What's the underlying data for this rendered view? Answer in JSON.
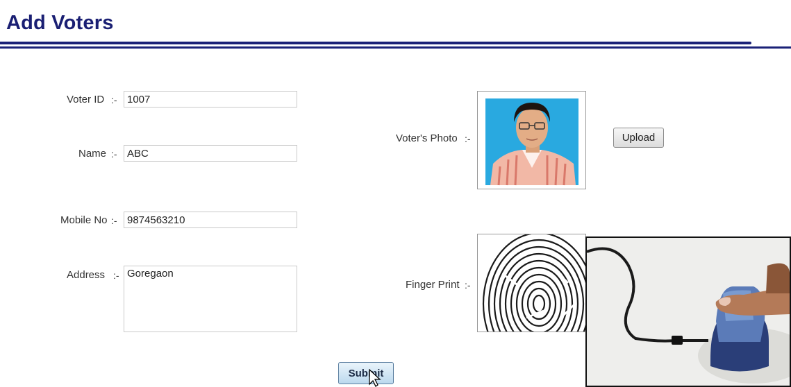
{
  "page": {
    "title": "Add Voters"
  },
  "form": {
    "voter_id": {
      "label": "Voter ID",
      "separator": ":-",
      "value": "1007"
    },
    "name": {
      "label": "Name",
      "separator": ":-",
      "value": "ABC"
    },
    "mobile_no": {
      "label": "Mobile No",
      "separator": ":-",
      "value": "9874563210"
    },
    "address": {
      "label": "Address",
      "separator": ":-",
      "value": "Goregaon"
    },
    "photo": {
      "label": "Voter's Photo",
      "separator": ":-"
    },
    "fingerprint": {
      "label": "Finger Print",
      "separator": ":-"
    }
  },
  "buttons": {
    "upload": "Upload",
    "submit": "Submit"
  },
  "colors": {
    "title": "#1a1f73",
    "rule": "#1b2177",
    "photo_background": "#29a9e0"
  },
  "icons": [
    "person-photo",
    "fingerprint-image",
    "fingerprint-scanner-video",
    "mouse-cursor-icon"
  ]
}
